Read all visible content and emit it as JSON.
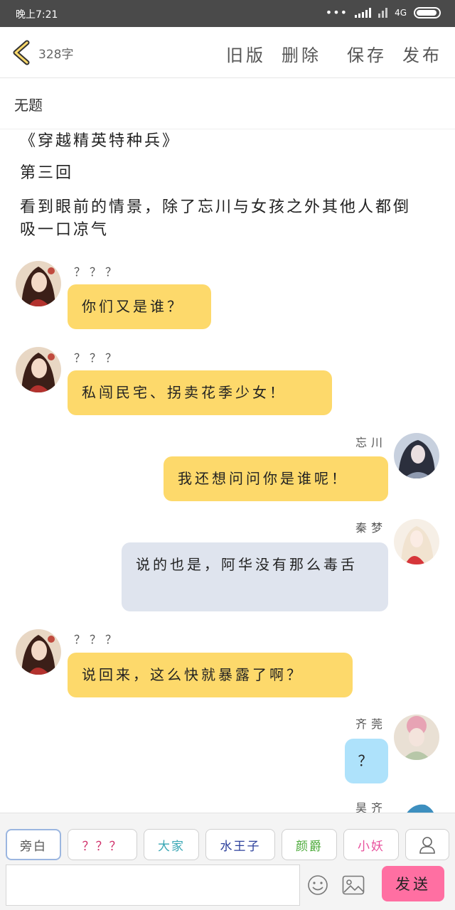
{
  "status": {
    "time": "晚上7:21",
    "dots": "•••",
    "network": "4G"
  },
  "header": {
    "word_count": "328字",
    "old_version": "旧版",
    "delete": "删除",
    "save": "保存",
    "publish": "发布"
  },
  "title": "无题",
  "paragraphs": [
    "《穿越精英特种兵》",
    "第三回",
    "看到眼前的情景，除了忘川与女孩之外其他人都倒吸一口凉气"
  ],
  "messages": [
    {
      "speaker": "？？？",
      "side": "left",
      "text": "你们又是谁？"
    },
    {
      "speaker": "？？？",
      "side": "left",
      "text": "私闯民宅、拐卖花季少女！"
    },
    {
      "speaker": "忘川",
      "side": "right",
      "text": "我还想问问你是谁呢！"
    },
    {
      "speaker": "秦梦",
      "side": "right",
      "text": "说的也是，阿华没有那么毒舌"
    },
    {
      "speaker": "？？？",
      "side": "left",
      "text": "说回来，这么快就暴露了啊？"
    },
    {
      "speaker": "齐莞",
      "side": "right",
      "text": "？"
    },
    {
      "speaker": "昊齐",
      "side": "right",
      "text": ""
    }
  ],
  "chips": [
    {
      "label": "旁白",
      "color": "#555555"
    },
    {
      "label": "？？？",
      "color": "#d0306a"
    },
    {
      "label": "大家",
      "color": "#3aa7b5"
    },
    {
      "label": "水王子",
      "color": "#2b3f9b"
    },
    {
      "label": "颜爵",
      "color": "#4caa3a"
    },
    {
      "label": "小妖",
      "color": "#e8509c"
    }
  ],
  "input": {
    "placeholder": ""
  },
  "send_label": "发送",
  "colors": {
    "bubble_left": "#fdd96b",
    "bubble_self": "#fdd96b",
    "bubble_grey": "#dfe4ee",
    "bubble_blue": "#aee2fb",
    "send": "#ff6fa2"
  }
}
